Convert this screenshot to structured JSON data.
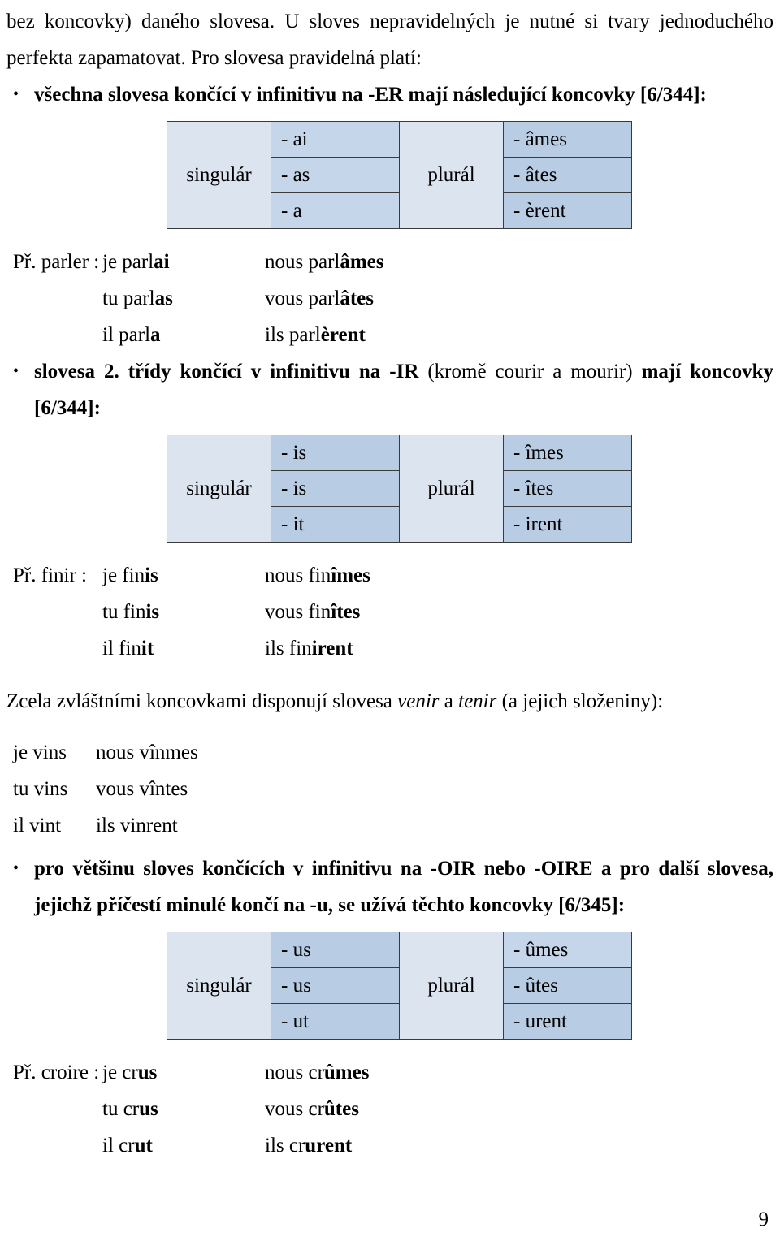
{
  "document": {
    "page_number": "9",
    "intro": {
      "line1_part1": "bez koncovky) daného slovesa. U sloves nepravidelných je nutné si tvary jednoduchého perfekta zapamatovat. Pro slovesa pravidelná platí:"
    },
    "bullets": [
      {
        "marker": "•",
        "text_bold_1": "všechna slovesa končící v infinitivu na -ER mají následující koncovky [6/344]:",
        "text_normal": "",
        "text_bold_2": ""
      },
      {
        "marker": "•",
        "text_bold_1": "slovesa 2. třídy končící v infinitivu na -IR ",
        "text_normal": "(kromě courir a mourir) ",
        "text_bold_2": "mají koncovky [6/344]:"
      },
      {
        "marker": "•",
        "text_bold_1": "pro většinu sloves končících v infinitivu na -OIR nebo -OIRE a pro další slovesa, jejichž příčestí minulé končí na -u, se užívá těchto koncovky [6/345]:",
        "text_normal": "",
        "text_bold_2": ""
      }
    ],
    "tables": [
      {
        "singular_label": "singulár",
        "plural_label": "plurál",
        "singular_endings": [
          "- ai",
          "- as",
          "- a"
        ],
        "plural_endings": [
          "- âmes",
          "- âtes",
          "- èrent"
        ]
      },
      {
        "singular_label": "singulár",
        "plural_label": "plurál",
        "singular_endings": [
          "- is",
          "- is",
          "- it"
        ],
        "plural_endings": [
          "- îmes",
          "- îtes",
          "- irent"
        ]
      },
      {
        "singular_label": "singulár",
        "plural_label": "plurál",
        "singular_endings": [
          "- us",
          "- us",
          "- ut"
        ],
        "plural_endings": [
          "- ûmes",
          "- ûtes",
          "- urent"
        ]
      }
    ],
    "conjugations": [
      {
        "lead": "Př. parler :",
        "rows": [
          {
            "sg_stem": "je parl",
            "sg_end": "ai",
            "pl_stem": "nous parl",
            "pl_end": "âmes"
          },
          {
            "sg_stem": "tu parl",
            "sg_end": "as",
            "pl_stem": "vous parl",
            "pl_end": "âtes"
          },
          {
            "sg_stem": "il parl",
            "sg_end": "a",
            "pl_stem": "ils parl",
            "pl_end": "èrent"
          }
        ]
      },
      {
        "lead": "Př. finir :",
        "rows": [
          {
            "sg_stem": "je fin",
            "sg_end": "is",
            "pl_stem": "nous fin",
            "pl_end": "îmes"
          },
          {
            "sg_stem": "tu fin",
            "sg_end": "is",
            "pl_stem": "vous fin",
            "pl_end": "îtes"
          },
          {
            "sg_stem": "il fin",
            "sg_end": "it",
            "pl_stem": "ils fin",
            "pl_end": "irent"
          }
        ]
      },
      {
        "lead": "Př. croire :",
        "rows": [
          {
            "sg_stem": "je cr",
            "sg_end": "us",
            "pl_stem": "nous cr",
            "pl_end": "ûmes"
          },
          {
            "sg_stem": "tu cr",
            "sg_end": "us",
            "pl_stem": "vous cr",
            "pl_end": "ûtes"
          },
          {
            "sg_stem": "il cr",
            "sg_end": "ut",
            "pl_stem": "ils cr",
            "pl_end": "urent"
          }
        ]
      }
    ],
    "venir_section": {
      "intro_part1": "Zcela zvláštními koncovkami disponují slovesa ",
      "intro_italic1": "venir",
      "intro_part2": " a ",
      "intro_italic2": "tenir",
      "intro_part3": " (a jejich složeniny):",
      "rows": [
        {
          "sg": "je vins",
          "pl": "nous vînmes"
        },
        {
          "sg": "tu vins",
          "pl": "vous vîntes"
        },
        {
          "sg": "il vint",
          "pl": "ils vinrent"
        }
      ]
    }
  }
}
